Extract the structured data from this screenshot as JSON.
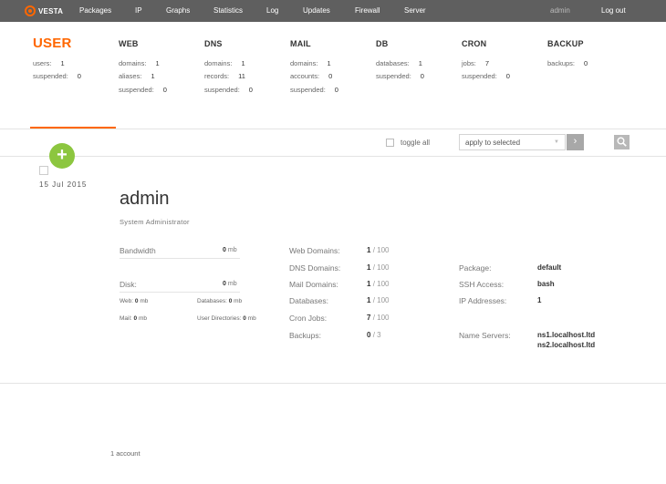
{
  "nav": {
    "logo": "VESTA",
    "items": [
      "Packages",
      "IP",
      "Graphs",
      "Statistics",
      "Log",
      "Updates",
      "Firewall",
      "Server"
    ],
    "user": "admin",
    "logout": "Log out"
  },
  "stats": {
    "user": {
      "title": "USER",
      "users_label": "users:",
      "users": "1",
      "suspended_label": "suspended:",
      "suspended": "0"
    },
    "web": {
      "title": "WEB",
      "domains_label": "domains:",
      "domains": "1",
      "aliases_label": "aliases:",
      "aliases": "1",
      "suspended_label": "suspended:",
      "suspended": "0"
    },
    "dns": {
      "title": "DNS",
      "domains_label": "domains:",
      "domains": "1",
      "records_label": "records:",
      "records": "11",
      "suspended_label": "suspended:",
      "suspended": "0"
    },
    "mail": {
      "title": "MAIL",
      "domains_label": "domains:",
      "domains": "1",
      "accounts_label": "accounts:",
      "accounts": "0",
      "suspended_label": "suspended:",
      "suspended": "0"
    },
    "db": {
      "title": "DB",
      "databases_label": "databases:",
      "databases": "1",
      "suspended_label": "suspended:",
      "suspended": "0"
    },
    "cron": {
      "title": "CRON",
      "jobs_label": "jobs:",
      "jobs": "7",
      "suspended_label": "suspended:",
      "suspended": "0"
    },
    "backup": {
      "title": "BACKUP",
      "backups_label": "backups:",
      "backups": "0"
    }
  },
  "toolbar": {
    "toggle_all": "toggle all",
    "action_selected": "apply to selected",
    "go_icon": "›"
  },
  "add_icon": "+",
  "user_row": {
    "date": "15  Jul  2015",
    "name": "admin",
    "role": "System Administrator",
    "bandwidth_label": "Bandwidth",
    "bandwidth_value": "0",
    "bandwidth_unit": "mb",
    "disk_label": "Disk:",
    "disk_value": "0",
    "disk_unit": "mb",
    "web_label": "Web:",
    "web_value": "0",
    "web_unit": "mb",
    "databases_label": "Databases:",
    "databases_value": "0",
    "databases_unit": "mb",
    "mail_label": "Mail:",
    "mail_value": "0",
    "mail_unit": "mb",
    "userdirs_label": "User Directories:",
    "userdirs_value": "0",
    "userdirs_unit": "mb",
    "limits": [
      {
        "label": "Web Domains:",
        "used": "1",
        "limit": "/ 100"
      },
      {
        "label": "DNS Domains:",
        "used": "1",
        "limit": "/ 100"
      },
      {
        "label": "Mail Domains:",
        "used": "1",
        "limit": "/ 100"
      },
      {
        "label": "Databases:",
        "used": "1",
        "limit": "/ 100"
      },
      {
        "label": "Cron Jobs:",
        "used": "7",
        "limit": "/ 100"
      },
      {
        "label": "Backups:",
        "used": "0",
        "limit": "/ 3"
      }
    ],
    "package_label": "Package:",
    "package": "default",
    "ssh_label": "SSH Access:",
    "ssh": "bash",
    "ip_label": "IP Addresses:",
    "ip_count": "1",
    "ns_label": "Name Servers:",
    "ns1": "ns1.localhost.ltd",
    "ns2": "ns2.localhost.ltd"
  },
  "footer": "1 account",
  "colors": {
    "accent": "#ff6701",
    "nav_bg": "#5f5f5f",
    "add": "#8cc63f"
  }
}
